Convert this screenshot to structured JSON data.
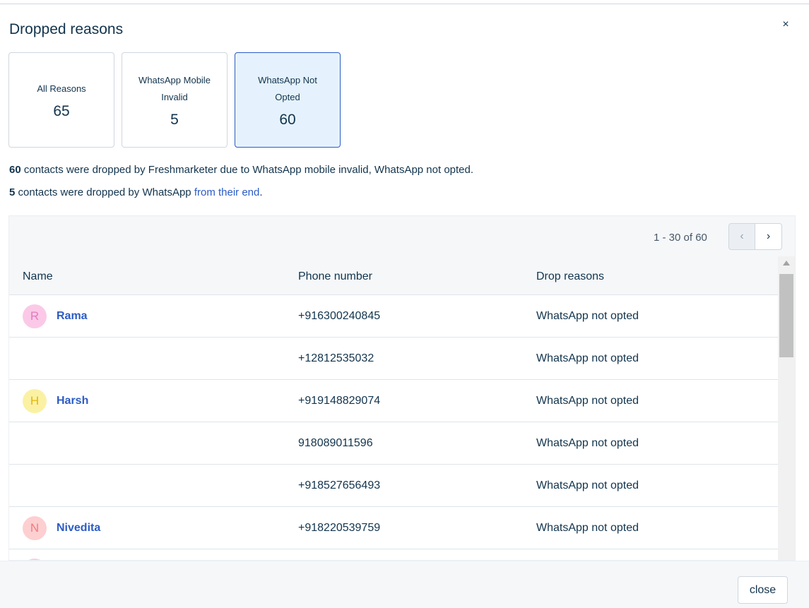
{
  "modal": {
    "title": "Dropped reasons",
    "close_icon": "×"
  },
  "cards": [
    {
      "label": "All Reasons",
      "count": "65",
      "active": false
    },
    {
      "label": "WhatsApp Mobile Invalid",
      "count": "5",
      "active": false
    },
    {
      "label": "WhatsApp Not Opted",
      "count": "60",
      "active": true
    }
  ],
  "description": {
    "line1_count": "60",
    "line1_text": " contacts were dropped by Freshmarketer due to WhatsApp mobile invalid, WhatsApp not opted.",
    "line2_count": "5",
    "line2_text": " contacts were dropped by WhatsApp ",
    "line2_link": "from their end",
    "line2_end": "."
  },
  "pagination": {
    "range_text": "1 - 30 of 60",
    "prev_icon": "‹",
    "next_icon": "›"
  },
  "table": {
    "headers": [
      "Name",
      "Phone number",
      "Drop reasons"
    ],
    "rows": [
      {
        "initial": "R",
        "name": "Rama",
        "phone": "+916300240845",
        "reason": "WhatsApp not opted",
        "avatar_bg": "#fbc9e7",
        "avatar_fg": "#e37bbd"
      },
      {
        "initial": "",
        "name": "",
        "phone": "+12812535032",
        "reason": "WhatsApp not opted",
        "avatar_bg": "",
        "avatar_fg": ""
      },
      {
        "initial": "H",
        "name": "Harsh",
        "phone": "+919148829074",
        "reason": "WhatsApp not opted",
        "avatar_bg": "#fbf1a3",
        "avatar_fg": "#e4b70b"
      },
      {
        "initial": "",
        "name": "",
        "phone": "918089011596",
        "reason": "WhatsApp not opted",
        "avatar_bg": "",
        "avatar_fg": ""
      },
      {
        "initial": "",
        "name": "",
        "phone": "+918527656493",
        "reason": "WhatsApp not opted",
        "avatar_bg": "",
        "avatar_fg": ""
      },
      {
        "initial": "N",
        "name": "Nivedita",
        "phone": "+918220539759",
        "reason": "WhatsApp not opted",
        "avatar_bg": "#fdcfd0",
        "avatar_fg": "#f07c80"
      },
      {
        "initial": "",
        "name": "",
        "phone": "",
        "reason": "",
        "avatar_bg": "#fbc9e7",
        "avatar_fg": "#e37bbd"
      }
    ]
  },
  "footer": {
    "close_label": "close"
  }
}
